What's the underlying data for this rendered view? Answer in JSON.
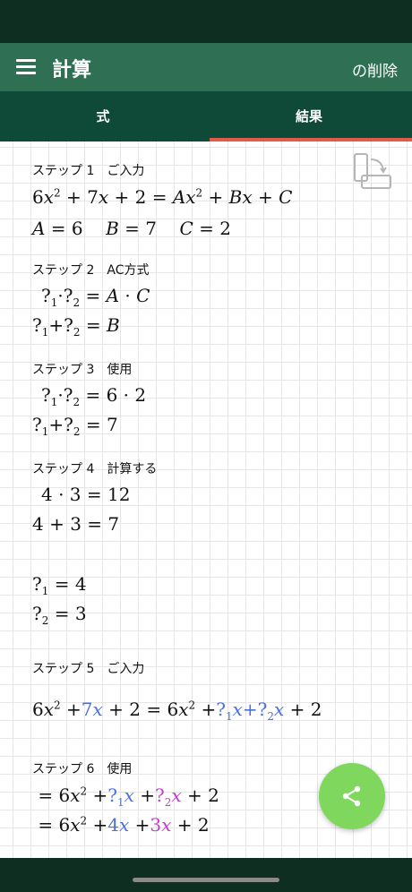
{
  "app": {
    "title": "計算",
    "delete_action": "の削除"
  },
  "tabs": [
    {
      "label": "式",
      "active": false
    },
    {
      "label": "結果",
      "active": true
    }
  ],
  "colors": {
    "status_bar": "#0f2e22",
    "app_bar": "#2f7054",
    "tab_bar": "#0f4a38",
    "tab_indicator": "#e05b4b",
    "fab": "#7fd85d",
    "blue": "#4b6fdc",
    "pink": "#c33ec9"
  },
  "steps": [
    {
      "title": "ステップ 1　ご入力"
    },
    {
      "title": "ステップ 2　AC方式"
    },
    {
      "title": "ステップ 3　使用"
    },
    {
      "title": "ステップ 4　計算する"
    },
    {
      "title": "ステップ 5　ご入力"
    },
    {
      "title": "ステップ 6　使用"
    }
  ],
  "icons": {
    "menu": "hamburger-icon",
    "rotate": "rotate-screen-icon",
    "share": "share-icon"
  }
}
